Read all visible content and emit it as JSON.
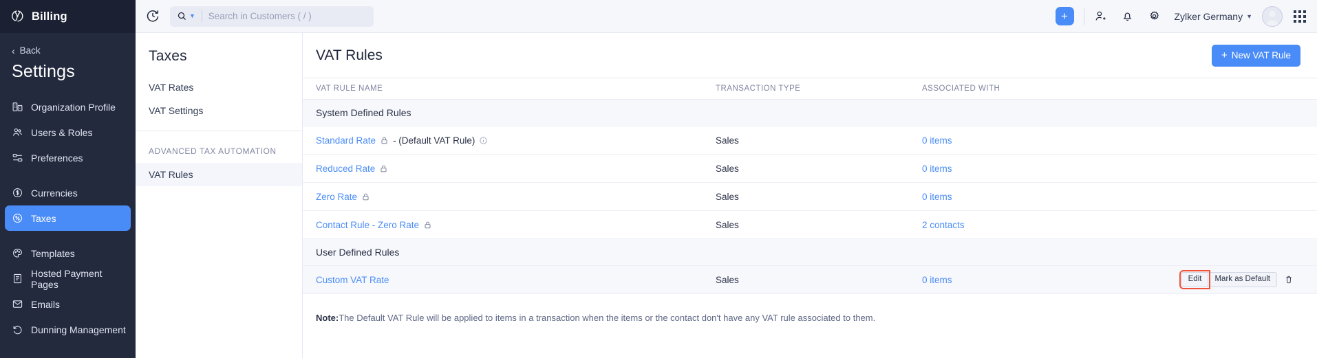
{
  "sidebar": {
    "brand": "Billing",
    "back_label": "Back",
    "section_title": "Settings",
    "items": [
      {
        "label": "Organization Profile",
        "icon": "building-icon",
        "active": false
      },
      {
        "label": "Users & Roles",
        "icon": "users-icon",
        "active": false
      },
      {
        "label": "Preferences",
        "icon": "sliders-icon",
        "active": false
      },
      {
        "label": "Currencies",
        "icon": "dollar-circle-icon",
        "active": false
      },
      {
        "label": "Taxes",
        "icon": "percent-circle-icon",
        "active": true
      },
      {
        "label": "Templates",
        "icon": "palette-icon",
        "active": false
      },
      {
        "label": "Hosted Payment Pages",
        "icon": "page-icon",
        "active": false
      },
      {
        "label": "Emails",
        "icon": "envelope-icon",
        "active": false
      },
      {
        "label": "Dunning Management",
        "icon": "undo-icon",
        "active": false
      }
    ]
  },
  "topbar": {
    "refresh_icon": "clock-refresh-icon",
    "search_icon": "search-icon",
    "search_placeholder": "Search in Customers ( / )",
    "search_value": "",
    "add_label": "+",
    "contacts_icon": "user-add-icon",
    "bell_icon": "bell-icon",
    "settings_icon": "gear-icon",
    "org_name": "Zylker Germany",
    "avatar_name": "avatar",
    "apps_icon": "grid-apps-icon"
  },
  "subnav": {
    "title": "Taxes",
    "items": [
      {
        "label": "VAT Rates",
        "active": false
      },
      {
        "label": "VAT Settings",
        "active": false
      }
    ],
    "group_label": "ADVANCED TAX AUTOMATION",
    "group_items": [
      {
        "label": "VAT Rules",
        "active": true
      }
    ]
  },
  "main": {
    "title": "VAT Rules",
    "new_button_label": "New VAT Rule",
    "columns": [
      "VAT RULE NAME",
      "TRANSACTION TYPE",
      "ASSOCIATED WITH",
      ""
    ],
    "groups": [
      {
        "group_label": "System Defined Rules",
        "rows": [
          {
            "name": "Standard Rate",
            "locked": true,
            "suffix": "- (Default VAT Rule)",
            "info": true,
            "transaction_type": "Sales",
            "associated_with": "0 items",
            "hovered": false,
            "actions": []
          },
          {
            "name": "Reduced Rate",
            "locked": true,
            "suffix": "",
            "info": false,
            "transaction_type": "Sales",
            "associated_with": "0 items",
            "hovered": false,
            "actions": []
          },
          {
            "name": "Zero Rate",
            "locked": true,
            "suffix": "",
            "info": false,
            "transaction_type": "Sales",
            "associated_with": "0 items",
            "hovered": false,
            "actions": []
          },
          {
            "name": "Contact Rule - Zero Rate",
            "locked": true,
            "suffix": "",
            "info": false,
            "transaction_type": "Sales",
            "associated_with": "2 contacts",
            "hovered": false,
            "actions": []
          }
        ]
      },
      {
        "group_label": "User Defined Rules",
        "rows": [
          {
            "name": "Custom VAT Rate",
            "locked": false,
            "suffix": "",
            "info": false,
            "transaction_type": "Sales",
            "associated_with": "0 items",
            "hovered": true,
            "actions": [
              "Edit",
              "Mark as Default"
            ],
            "delete_icon": "trash-icon",
            "focused_action": "Edit"
          }
        ]
      }
    ],
    "note_prefix": "Note:",
    "note_text": "The Default VAT Rule will be applied to items in a transaction when the items or the contact don't have any VAT rule associated to them."
  },
  "colors": {
    "accent": "#4a8cf7",
    "sidebar_bg": "#232a3e",
    "brand_bg": "#1b2132",
    "focus_outline": "#f0533a",
    "row_hover": "#f7f8fc"
  }
}
